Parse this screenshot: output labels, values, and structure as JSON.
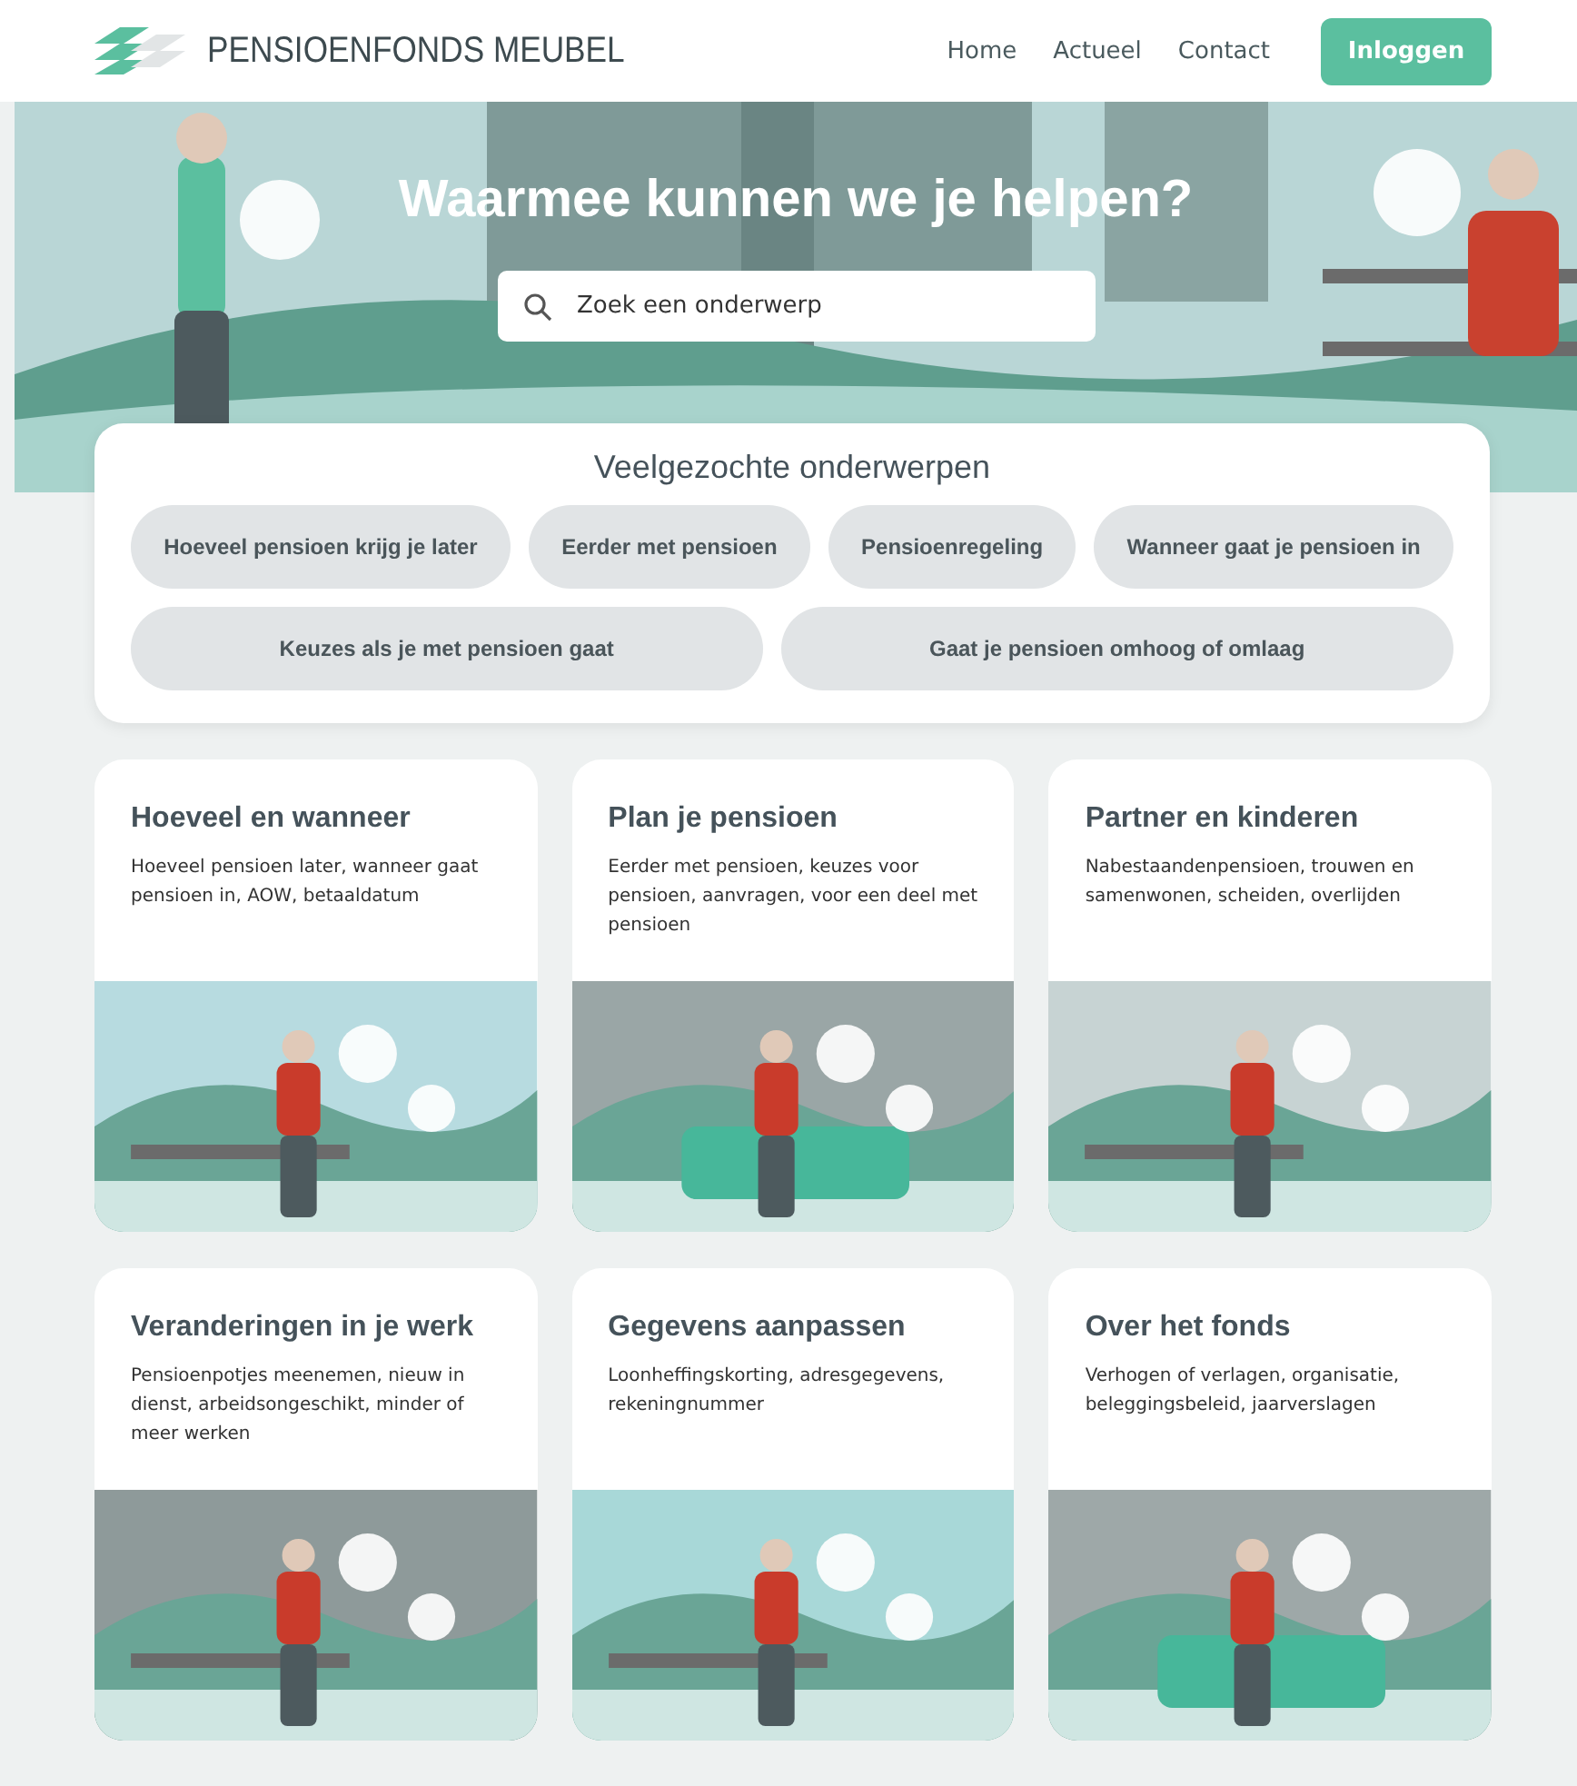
{
  "header": {
    "brand": "PENSIOENFONDS MEUBEL",
    "nav": [
      {
        "label": "Home"
      },
      {
        "label": "Actueel"
      },
      {
        "label": "Contact"
      }
    ],
    "login": "Inloggen"
  },
  "hero": {
    "title": "Waarmee kunnen we je helpen?",
    "search": {
      "placeholder": "Zoek een onderwerp"
    }
  },
  "popular": {
    "title": "Veelgezochte onderwerpen",
    "chips": [
      "Hoeveel pensioen krijg je later",
      "Eerder met pensioen",
      "Pensioenregeling",
      "Wanneer gaat je pensioen in",
      "Keuzes als je met pensioen gaat",
      "Gaat je pensioen omhoog of omlaag"
    ]
  },
  "topics": [
    {
      "title": "Hoeveel en wanneer",
      "text": "Hoeveel pensioen later, wanneer gaat pensioen in, AOW, betaaldatum"
    },
    {
      "title": "Plan je pensioen",
      "text": "Eerder met pensioen, keuzes voor pensioen, aanvragen, voor een deel met pensioen"
    },
    {
      "title": "Partner en kinderen",
      "text": "Nabestaandenpensioen, trouwen en samenwonen, scheiden, overlijden"
    },
    {
      "title": "Veranderingen in je werk",
      "text": "Pensioenpotjes meenemen, nieuw in dienst, arbeidsongeschikt, minder of meer werken"
    },
    {
      "title": "Gegevens aanpassen",
      "text": "Loonheffingskorting, adresgegevens, rekeningnummer"
    },
    {
      "title": "Over het fonds",
      "text": "Verhogen of verlagen, organisatie, beleggingsbeleid, jaarverslagen"
    }
  ]
}
